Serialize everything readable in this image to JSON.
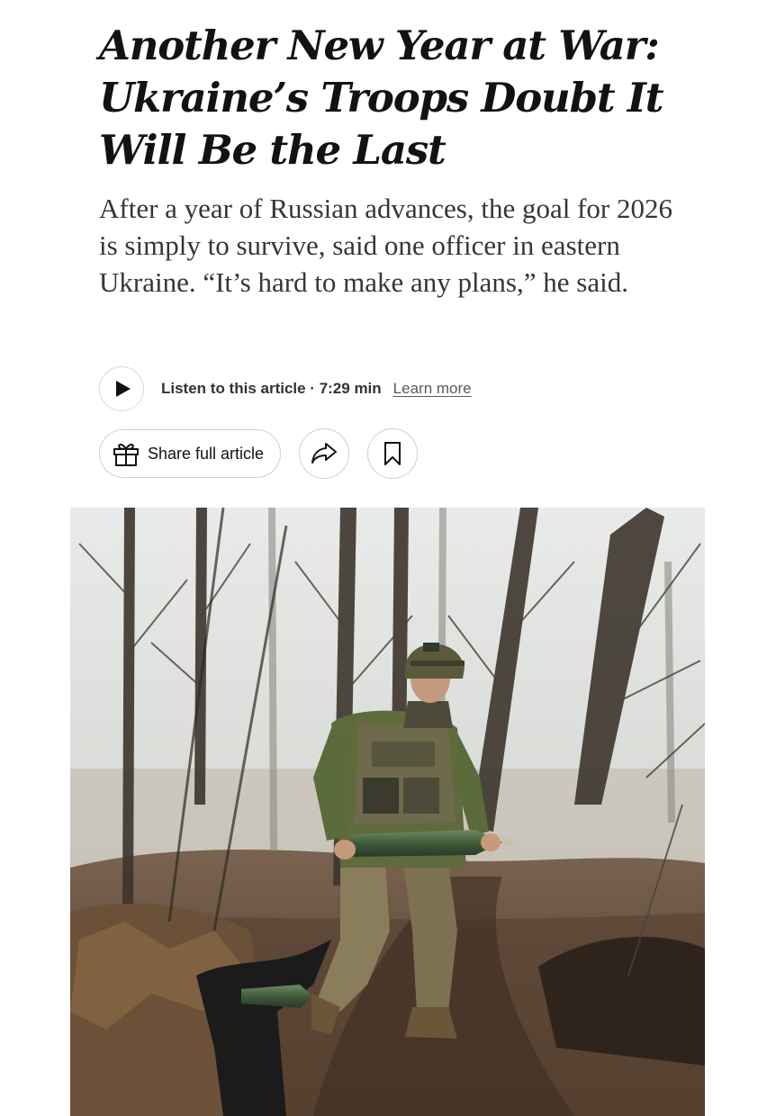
{
  "article": {
    "headline": "Another New Year at War: Ukraine’s Troops Doubt It Will Be the Last",
    "summary": "After a year of Russian advances, the goal for 2026 is simply to survive, said one officer in eastern Ukraine. “It’s hard to make any plans,” he said."
  },
  "audio": {
    "play_icon": "play-icon",
    "listen_label": "Listen to this article · 7:29 min",
    "learn_more": "Learn more"
  },
  "actions": {
    "share_full_label": "Share full article",
    "gift_icon": "gift-icon",
    "share_icon": "share-arrow-icon",
    "bookmark_icon": "bookmark-icon"
  },
  "photo": {
    "subject": "soldier-carrying-artillery-shell-in-foggy-forest"
  },
  "colors": {
    "text": "#121212",
    "summary_text": "#363636",
    "border": "#d0d0d0"
  }
}
